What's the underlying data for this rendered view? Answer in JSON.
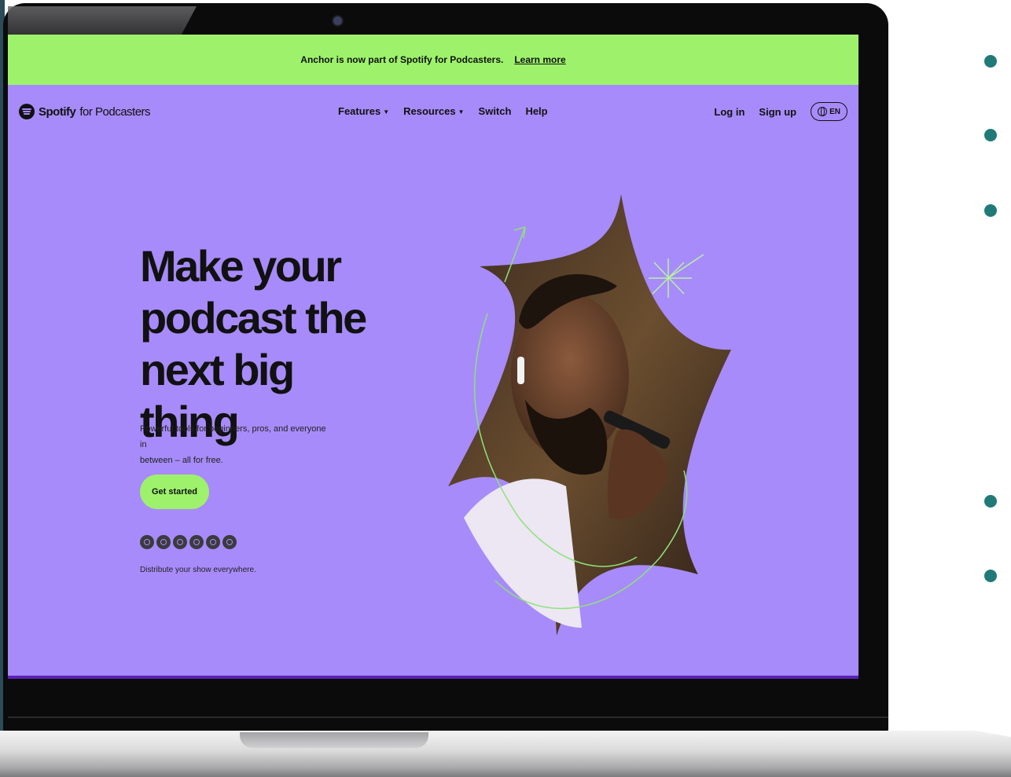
{
  "banner": {
    "text": "Anchor is now part of Spotify for Podcasters.",
    "link": "Learn more"
  },
  "header": {
    "brand_bold": "Spotify",
    "brand_rest": "for Podcasters",
    "nav": [
      {
        "label": "Features",
        "has_caret": true
      },
      {
        "label": "Resources",
        "has_caret": true
      },
      {
        "label": "Switch",
        "has_caret": false
      },
      {
        "label": "Help",
        "has_caret": false
      }
    ],
    "login": "Log in",
    "signup": "Sign up",
    "language": "EN"
  },
  "hero": {
    "title_line1": "Make your",
    "title_line2": "podcast the",
    "title_line3": "next big thing",
    "subtitle_line1": "Powerful tools for beginners, pros, and everyone in",
    "subtitle_line2": "between – all for free.",
    "cta": "Get started",
    "distribute": "Distribute your show everywhere."
  },
  "platform_icons": [
    "spotify-icon",
    "apple-podcasts-icon",
    "google-podcasts-icon",
    "amazon-music-icon",
    "overcast-icon",
    "pocket-casts-icon"
  ],
  "colors": {
    "background": "#a78bfa",
    "banner": "#9ef26b",
    "cta": "#9ef26b",
    "text": "#111111",
    "bullets": "#1f7a78"
  }
}
